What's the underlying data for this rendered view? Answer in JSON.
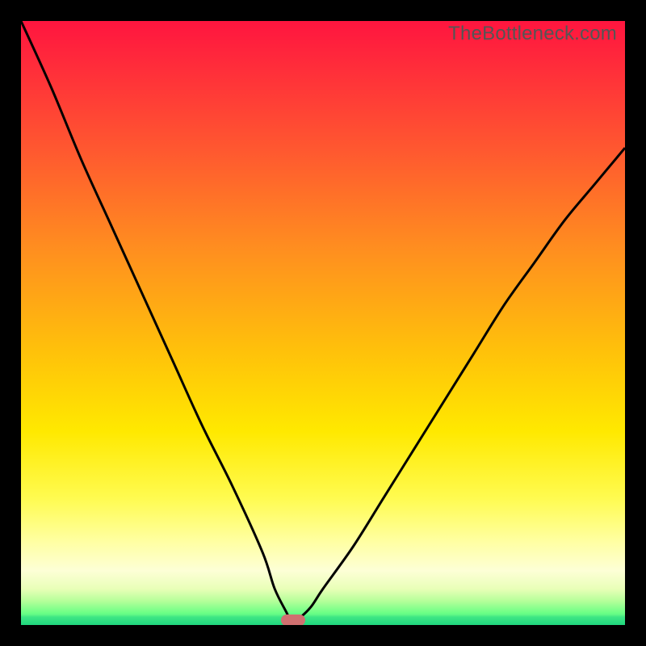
{
  "watermark": "TheBottleneck.com",
  "colors": {
    "frame": "#000000",
    "curve_stroke": "#000000",
    "marker_fill": "#d07070",
    "gradient_top": "#ff153f",
    "gradient_bottom": "#1fd77e"
  },
  "chart_data": {
    "type": "line",
    "title": "",
    "xlabel": "",
    "ylabel": "",
    "xlim": [
      0,
      100
    ],
    "ylim": [
      0,
      100
    ],
    "x": [
      0,
      5,
      10,
      15,
      20,
      25,
      30,
      35,
      40,
      42,
      44,
      45,
      46,
      48,
      50,
      55,
      60,
      65,
      70,
      75,
      80,
      85,
      90,
      95,
      100
    ],
    "values": [
      100,
      89,
      77,
      66,
      55,
      44,
      33,
      23,
      12,
      6,
      2,
      0,
      1,
      3,
      6,
      13,
      21,
      29,
      37,
      45,
      53,
      60,
      67,
      73,
      79
    ],
    "minimum": {
      "x": 45,
      "y": 0
    },
    "annotations": [
      {
        "kind": "marker",
        "x": 45,
        "y": 0,
        "shape": "rounded-rect",
        "color": "#d07070"
      }
    ]
  }
}
